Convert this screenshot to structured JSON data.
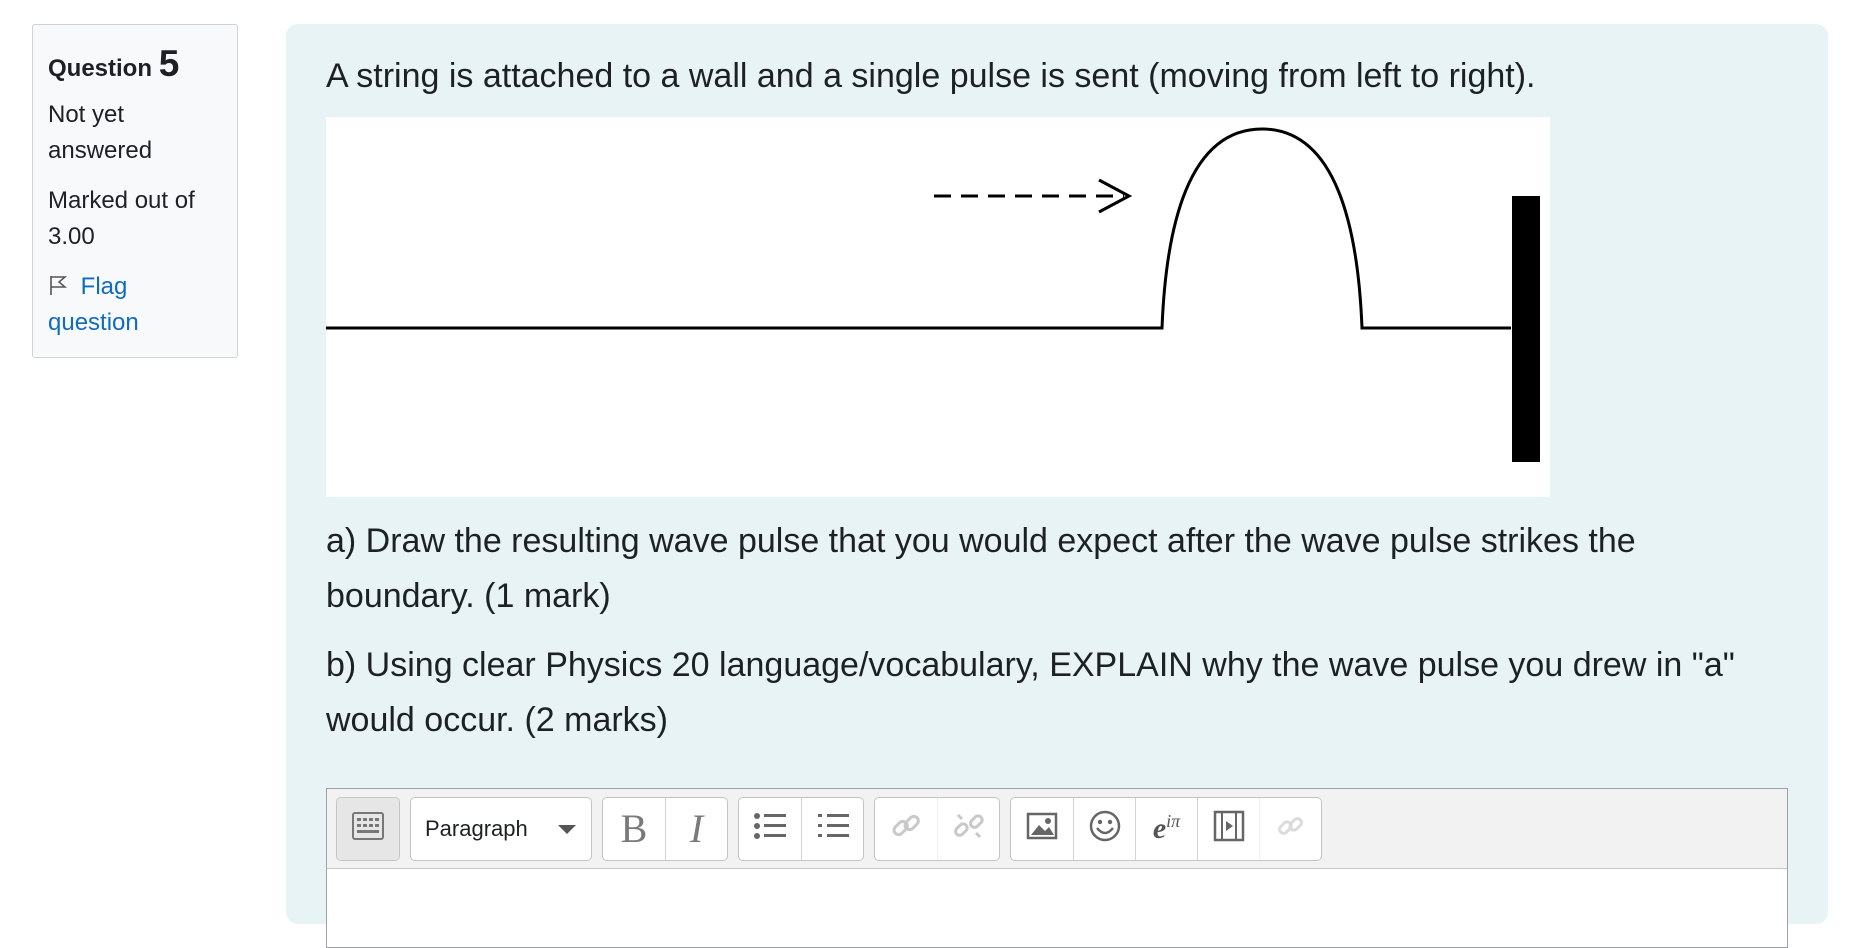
{
  "question_info": {
    "label": "Question",
    "number": "5",
    "state": "Not yet answered",
    "grade": "Marked out of 3.00",
    "flag_label": "Flag question"
  },
  "question": {
    "text": "A string is attached to a wall and a single pulse is sent (moving from left to right).",
    "part_a": "a)  Draw the resulting wave pulse that you would expect after the wave pulse strikes the boundary.  (1 mark)",
    "part_b": "b)  Using clear Physics 20 language/vocabulary, EXPLAIN why the wave pulse you drew in \"a\" would occur.  (2 marks)"
  },
  "editor": {
    "paragraph_select": "Paragraph",
    "buttons": [
      "toggle-toolbar",
      "bold",
      "italic",
      "unordered-list",
      "ordered-list",
      "link",
      "unlink",
      "image",
      "emoji",
      "equation",
      "media",
      "manage-files"
    ]
  },
  "colors": {
    "accent": "#0f6cbf",
    "content_bg": "#e7f3f5",
    "info_bg": "#f8f9fa"
  }
}
